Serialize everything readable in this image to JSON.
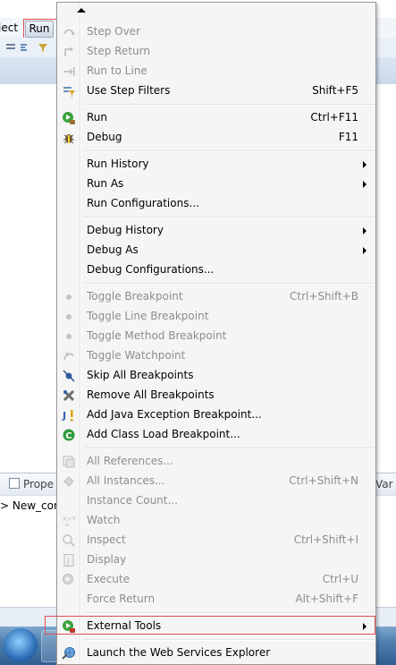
{
  "menubar": {
    "project_label": "ject",
    "run_label": "Run"
  },
  "properties_view": {
    "tab_label": "Prope",
    "variables_tab_label": "Var",
    "row_text": "> New_cor"
  },
  "menu": {
    "items": [
      {
        "label": "Step Over",
        "accel": "",
        "enabled": false,
        "submenu": false,
        "icon": "step-over-icon"
      },
      {
        "label": "Step Return",
        "accel": "",
        "enabled": false,
        "submenu": false,
        "icon": "step-return-icon"
      },
      {
        "label": "Run to Line",
        "accel": "",
        "enabled": false,
        "submenu": false,
        "icon": "run-to-line-icon"
      },
      {
        "label": "Use Step Filters",
        "accel": "Shift+F5",
        "enabled": true,
        "submenu": false,
        "icon": "step-filters-icon"
      },
      {
        "label": "Run",
        "accel": "Ctrl+F11",
        "enabled": true,
        "submenu": false,
        "icon": "run-icon"
      },
      {
        "label": "Debug",
        "accel": "F11",
        "enabled": true,
        "submenu": false,
        "icon": "debug-bug-icon"
      },
      {
        "label": "Run History",
        "accel": "",
        "enabled": true,
        "submenu": true,
        "icon": ""
      },
      {
        "label": "Run As",
        "accel": "",
        "enabled": true,
        "submenu": true,
        "icon": ""
      },
      {
        "label": "Run Configurations...",
        "accel": "",
        "enabled": true,
        "submenu": false,
        "icon": ""
      },
      {
        "label": "Debug History",
        "accel": "",
        "enabled": true,
        "submenu": true,
        "icon": ""
      },
      {
        "label": "Debug As",
        "accel": "",
        "enabled": true,
        "submenu": true,
        "icon": ""
      },
      {
        "label": "Debug Configurations...",
        "accel": "",
        "enabled": true,
        "submenu": false,
        "icon": ""
      },
      {
        "label": "Toggle Breakpoint",
        "accel": "Ctrl+Shift+B",
        "enabled": false,
        "submenu": false,
        "icon": "breakpoint-dot-icon"
      },
      {
        "label": "Toggle Line Breakpoint",
        "accel": "",
        "enabled": false,
        "submenu": false,
        "icon": "breakpoint-dot-icon"
      },
      {
        "label": "Toggle Method Breakpoint",
        "accel": "",
        "enabled": false,
        "submenu": false,
        "icon": "breakpoint-dot-icon"
      },
      {
        "label": "Toggle Watchpoint",
        "accel": "",
        "enabled": false,
        "submenu": false,
        "icon": "watchpoint-icon"
      },
      {
        "label": "Skip All Breakpoints",
        "accel": "",
        "enabled": true,
        "submenu": false,
        "icon": "skip-breakpoints-icon"
      },
      {
        "label": "Remove All Breakpoints",
        "accel": "",
        "enabled": true,
        "submenu": false,
        "icon": "remove-breakpoints-icon"
      },
      {
        "label": "Add Java Exception Breakpoint...",
        "accel": "",
        "enabled": true,
        "submenu": false,
        "icon": "exception-breakpoint-icon"
      },
      {
        "label": "Add Class Load Breakpoint...",
        "accel": "",
        "enabled": true,
        "submenu": false,
        "icon": "class-load-icon"
      },
      {
        "label": "All References...",
        "accel": "",
        "enabled": false,
        "submenu": false,
        "icon": "references-icon"
      },
      {
        "label": "All Instances...",
        "accel": "Ctrl+Shift+N",
        "enabled": false,
        "submenu": false,
        "icon": "instances-icon"
      },
      {
        "label": "Instance Count...",
        "accel": "",
        "enabled": false,
        "submenu": false,
        "icon": ""
      },
      {
        "label": "Watch",
        "accel": "",
        "enabled": false,
        "submenu": false,
        "icon": "watch-icon"
      },
      {
        "label": "Inspect",
        "accel": "Ctrl+Shift+I",
        "enabled": false,
        "submenu": false,
        "icon": "inspect-icon"
      },
      {
        "label": "Display",
        "accel": "",
        "enabled": false,
        "submenu": false,
        "icon": "display-icon"
      },
      {
        "label": "Execute",
        "accel": "Ctrl+U",
        "enabled": false,
        "submenu": false,
        "icon": "execute-icon"
      },
      {
        "label": "Force Return",
        "accel": "Alt+Shift+F",
        "enabled": false,
        "submenu": false,
        "icon": ""
      },
      {
        "label": "External Tools",
        "accel": "",
        "enabled": true,
        "submenu": true,
        "icon": "external-tools-icon"
      },
      {
        "label": "Launch the Web Services Explorer",
        "accel": "",
        "enabled": true,
        "submenu": false,
        "icon": "web-services-icon"
      }
    ]
  },
  "colors": {
    "highlight": "#e05050",
    "disabled_text": "#8d8d8d",
    "menu_bg": "#f5f5f5"
  }
}
